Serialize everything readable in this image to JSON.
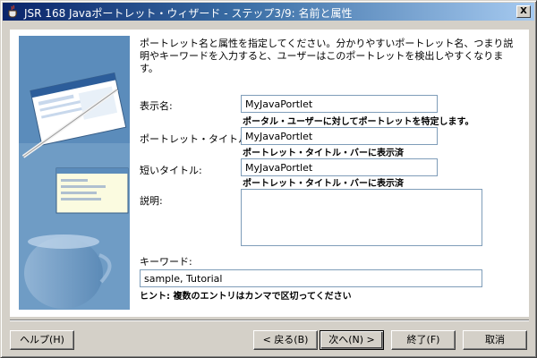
{
  "window": {
    "title": "JSR 168 Javaポートレット・ウィザード - ステップ3/9: 名前と属性",
    "close_symbol": "X"
  },
  "description": "ポートレット名と属性を指定してください。分かりやすいポートレット名、つまり説明やキーワードを入力すると、ユーザーはこのポートレットを検出しやすくなります。",
  "fields": {
    "display_name": {
      "label": "表示名:",
      "value": "MyJavaPortlet",
      "hint": "ポータル・ユーザーに対してポートレットを特定します。"
    },
    "portlet_title": {
      "label": "ポートレット・タイトル:",
      "value": "MyJavaPortlet",
      "hint": "ポートレット・タイトル・バーに表示済"
    },
    "short_title": {
      "label": "短いタイトル:",
      "value": "MyJavaPortlet",
      "hint": "ポートレット・タイトル・バーに表示済"
    },
    "description_field": {
      "label": "説明:",
      "value": ""
    },
    "keywords": {
      "label": "キーワード:",
      "value": "sample, Tutorial",
      "hint": "ヒント: 複数のエントリはカンマで区切ってください"
    }
  },
  "buttons": {
    "help": "ヘルプ(H)",
    "back": "< 戻る(B)",
    "next": "次へ(N) >",
    "finish": "終了(F)",
    "cancel": "取消"
  },
  "icons": {
    "title_icon": "java-coffee-cup-icon",
    "side_art": "wizard-side-illustration"
  }
}
